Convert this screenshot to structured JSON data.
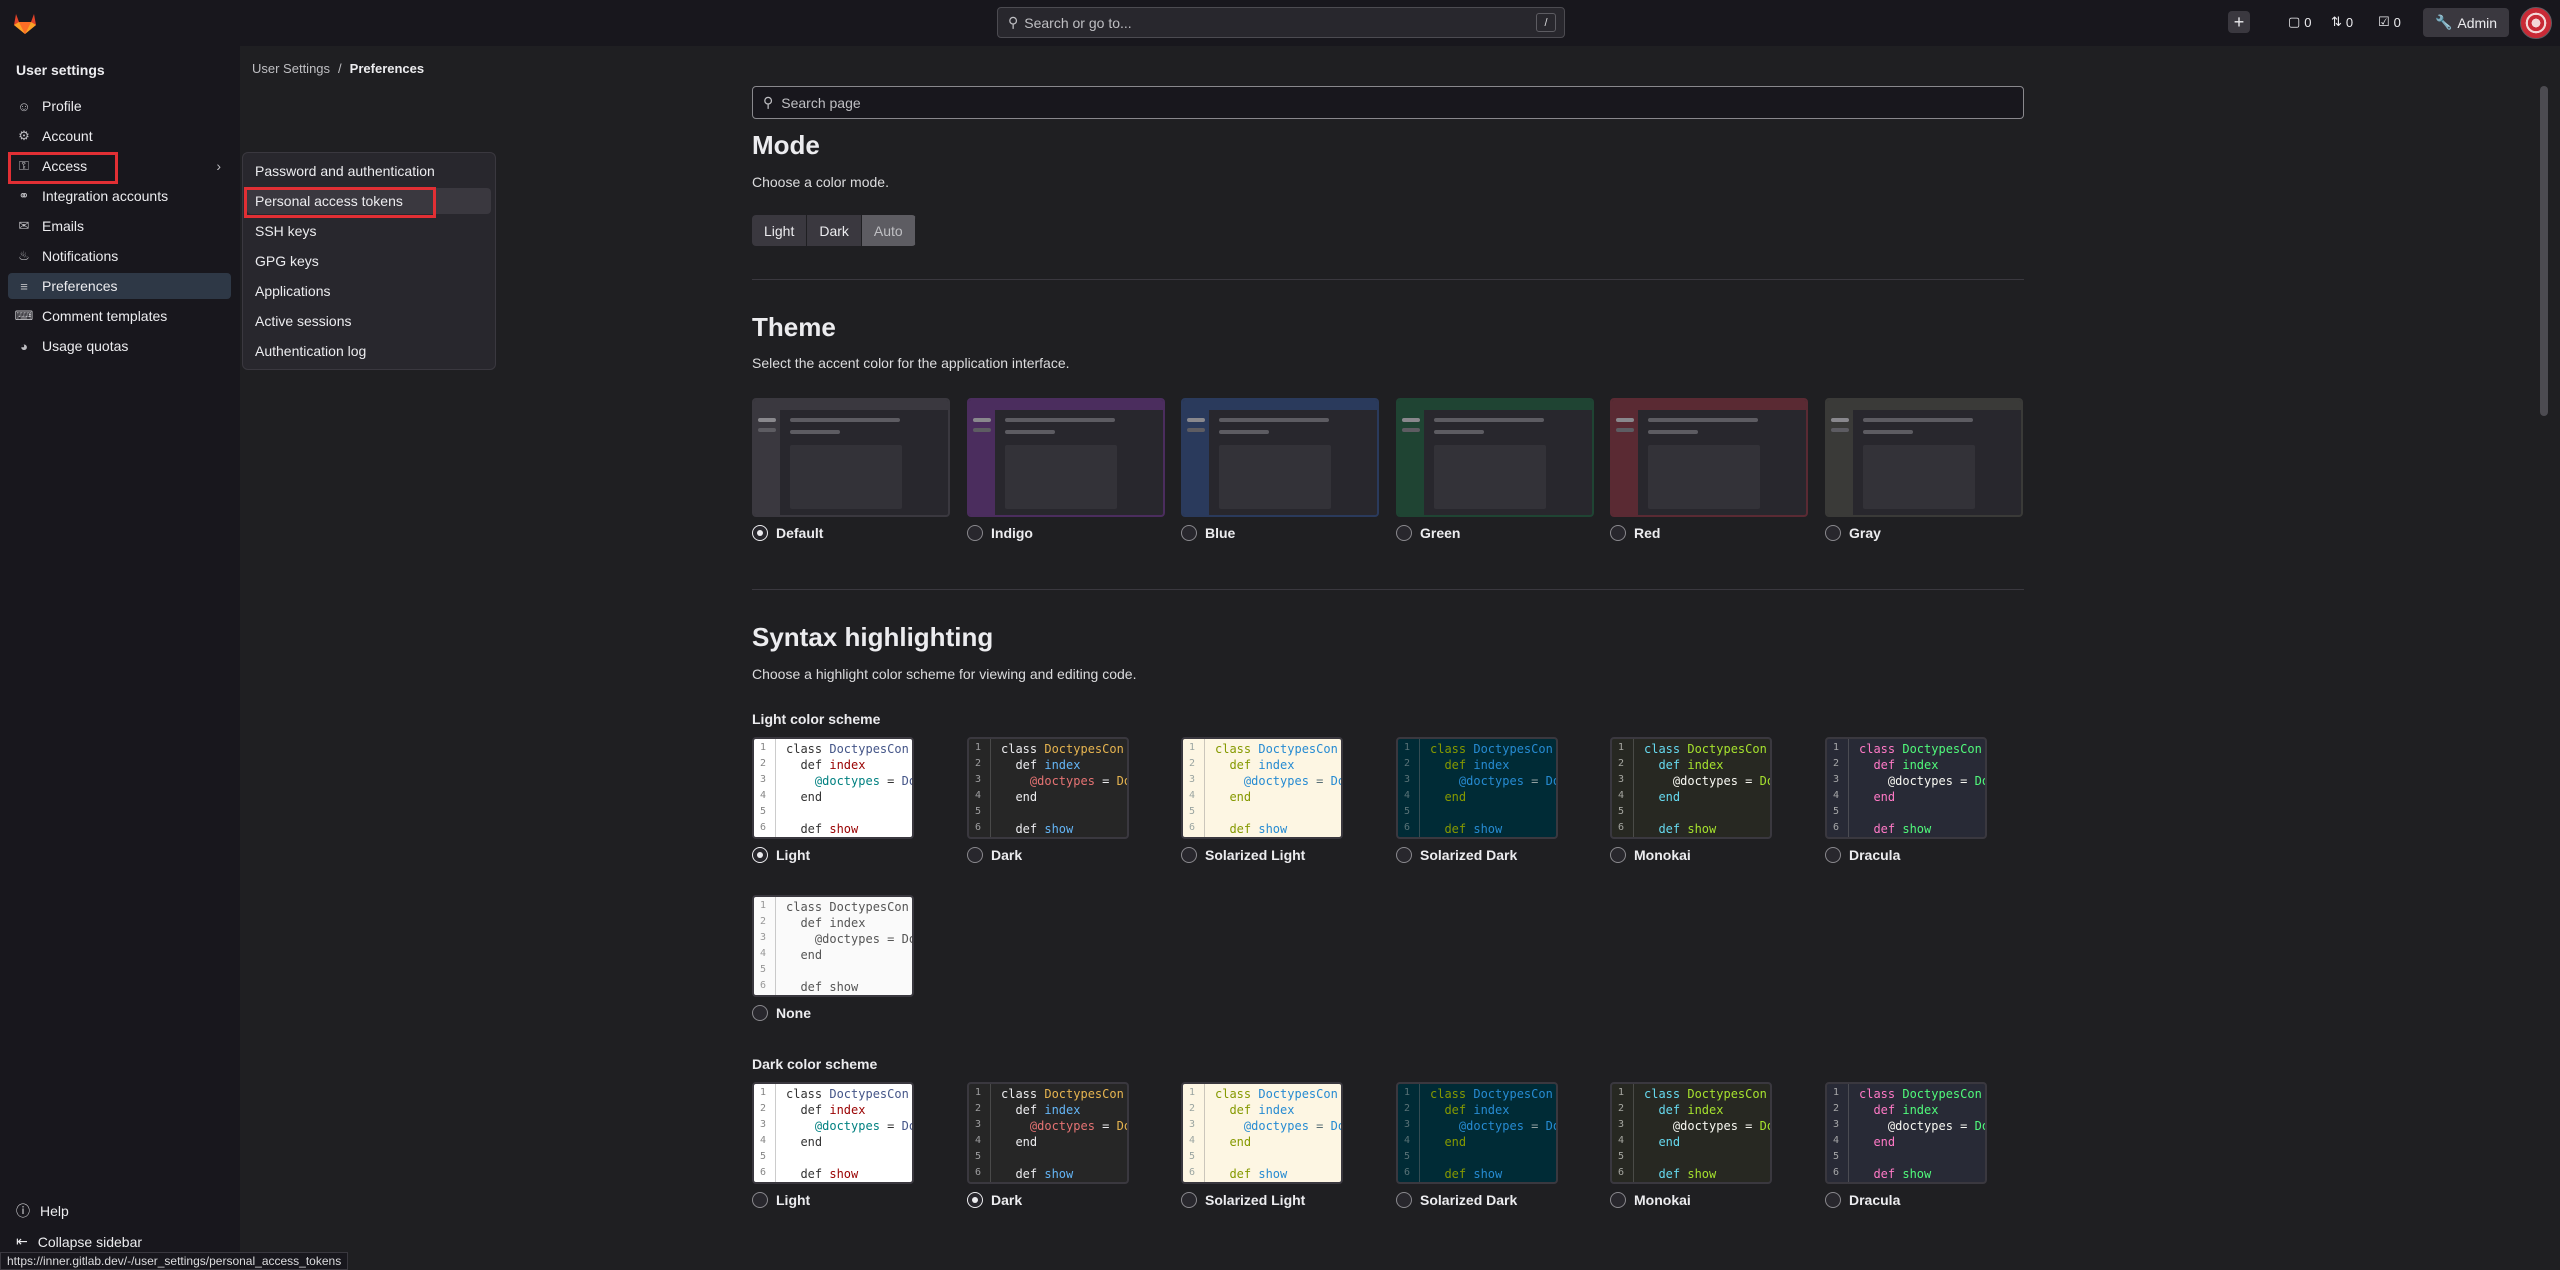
{
  "topbar": {
    "search_placeholder": "Search or go to...",
    "search_shortcut": "/",
    "plus_label": "+",
    "issues_count": "0",
    "mrs_count": "0",
    "todos_count": "0",
    "admin_label": "Admin"
  },
  "sidebar": {
    "title": "User settings",
    "items": [
      {
        "label": "Profile",
        "icon": "profile-icon"
      },
      {
        "label": "Account",
        "icon": "account-icon"
      },
      {
        "label": "Access",
        "icon": "key-icon"
      },
      {
        "label": "Integration accounts",
        "icon": "link-icon"
      },
      {
        "label": "Emails",
        "icon": "mail-icon"
      },
      {
        "label": "Notifications",
        "icon": "bell-icon"
      },
      {
        "label": "Preferences",
        "icon": "preferences-icon"
      },
      {
        "label": "Comment templates",
        "icon": "comment-icon"
      },
      {
        "label": "Usage quotas",
        "icon": "quota-icon"
      }
    ],
    "help": "Help",
    "collapse": "Collapse sidebar"
  },
  "flyout": {
    "items": [
      "Password and authentication",
      "Personal access tokens",
      "SSH keys",
      "GPG keys",
      "Applications",
      "Active sessions",
      "Authentication log"
    ]
  },
  "breadcrumb": {
    "parent": "User Settings",
    "separator": "/",
    "current": "Preferences"
  },
  "page_search": {
    "placeholder": "Search page"
  },
  "mode": {
    "title": "Mode",
    "description": "Choose a color mode.",
    "options": [
      "Light",
      "Dark",
      "Auto"
    ],
    "selected": "Auto"
  },
  "theme": {
    "title": "Theme",
    "description": "Select the accent color for the application interface.",
    "options": [
      {
        "label": "Default",
        "color": "#3a383f",
        "selected": true
      },
      {
        "label": "Indigo",
        "color": "#4b2d5e",
        "selected": false
      },
      {
        "label": "Blue",
        "color": "#2a3a5c",
        "selected": false
      },
      {
        "label": "Green",
        "color": "#1f4433",
        "selected": false
      },
      {
        "label": "Red",
        "color": "#5a2a33",
        "selected": false
      },
      {
        "label": "Gray",
        "color": "#3a3a38",
        "selected": false
      }
    ]
  },
  "syntax": {
    "title": "Syntax highlighting",
    "description": "Choose a highlight color scheme for viewing and editing code.",
    "light_heading": "Light color scheme",
    "dark_heading": "Dark color scheme",
    "light_options": [
      {
        "label": "Light",
        "selected": true
      },
      {
        "label": "Dark",
        "selected": false
      },
      {
        "label": "Solarized Light",
        "selected": false
      },
      {
        "label": "Solarized Dark",
        "selected": false
      },
      {
        "label": "Monokai",
        "selected": false
      },
      {
        "label": "Dracula",
        "selected": false
      },
      {
        "label": "None",
        "selected": false
      }
    ],
    "dark_options": [
      {
        "label": "Light",
        "selected": false
      },
      {
        "label": "Dark",
        "selected": true
      },
      {
        "label": "Solarized Light",
        "selected": false
      },
      {
        "label": "Solarized Dark",
        "selected": false
      },
      {
        "label": "Monokai",
        "selected": false
      },
      {
        "label": "Dracula",
        "selected": false
      }
    ],
    "code_lines": [
      {
        "n": "1",
        "text": "class DoctypesCon"
      },
      {
        "n": "2",
        "text": "  def index"
      },
      {
        "n": "3",
        "text": "    @doctypes = Do"
      },
      {
        "n": "4",
        "text": "  end"
      },
      {
        "n": "5",
        "text": ""
      },
      {
        "n": "6",
        "text": "  def show"
      }
    ]
  },
  "status_url": "https://inner.gitlab.dev/-/user_settings/personal_access_tokens"
}
